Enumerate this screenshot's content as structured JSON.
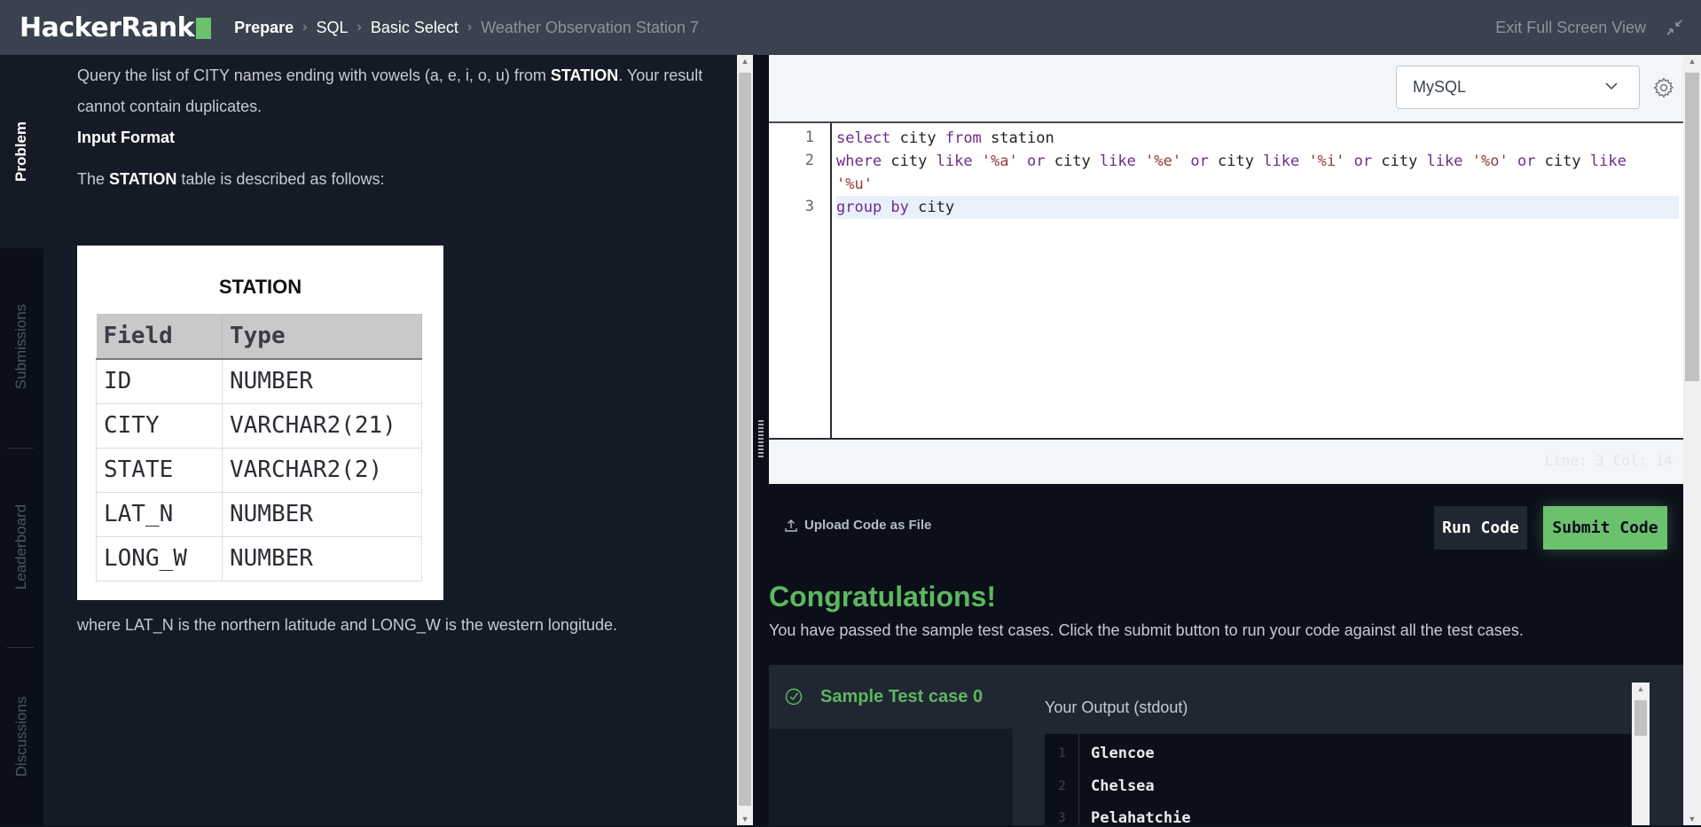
{
  "header": {
    "logo_text": "HackerRank",
    "breadcrumb": [
      {
        "label": "Prepare"
      },
      {
        "label": "SQL"
      },
      {
        "label": "Basic Select"
      },
      {
        "label": "Weather Observation Station 7"
      }
    ],
    "exit_fullscreen_label": "Exit Full Screen View",
    "brand_color": "#6cc16f"
  },
  "sidebar_tabs": [
    {
      "label": "Problem",
      "active": true
    },
    {
      "label": "Submissions",
      "active": false
    },
    {
      "label": "Leaderboard",
      "active": false
    },
    {
      "label": "Discussions",
      "active": false
    }
  ],
  "problem": {
    "statement_pre": "Query the list of CITY names ending with vowels (a, e, i, o, u) from ",
    "statement_bold": "STATION",
    "statement_post": ". Your result cannot contain duplicates.",
    "input_format_heading": "Input Format",
    "table_intro_pre": "The ",
    "table_intro_bold": "STATION",
    "table_intro_post": " table is described as follows:",
    "table_image": {
      "title": "STATION",
      "headers": [
        "Field",
        "Type"
      ],
      "rows": [
        [
          "ID",
          "NUMBER"
        ],
        [
          "CITY",
          "VARCHAR2(21)"
        ],
        [
          "STATE",
          "VARCHAR2(2)"
        ],
        [
          "LAT_N",
          "NUMBER"
        ],
        [
          "LONG_W",
          "NUMBER"
        ]
      ]
    },
    "footer_note": "where LAT_N is the northern latitude and LONG_W is the western longitude."
  },
  "editor": {
    "language": "MySQL",
    "lines": [
      {
        "number": "1",
        "text": "select city from station"
      },
      {
        "number": "2",
        "text": "where city like '%a' or city like '%e' or city like '%i' or city like '%o' or city like '%u'"
      },
      {
        "number": "3",
        "text": "group by city"
      }
    ],
    "cursor_position": "Line: 3 Col: 14"
  },
  "actions": {
    "upload_label": "Upload Code as File",
    "run_label": "Run Code",
    "submit_label": "Submit Code"
  },
  "result": {
    "title": "Congratulations!",
    "message": "You have passed the sample test cases. Click the submit button to run your code against all the test cases.",
    "test_cases": [
      {
        "label": "Sample Test case 0",
        "status": "passed"
      }
    ],
    "output_title": "Your Output (stdout)",
    "output_lines": [
      {
        "number": "1",
        "text": "Glencoe"
      },
      {
        "number": "2",
        "text": "Chelsea"
      },
      {
        "number": "3",
        "text": "Pelahatchie"
      }
    ],
    "success_color": "#5cb85f"
  }
}
